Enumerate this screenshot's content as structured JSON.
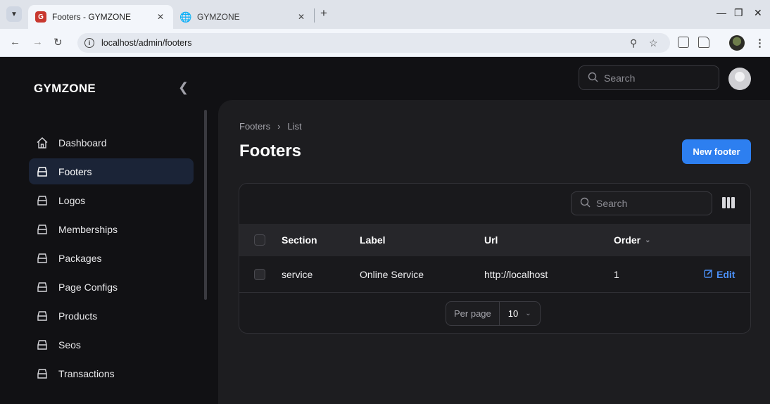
{
  "browser": {
    "tabs": [
      {
        "title": "Footers - GYMZONE",
        "active": true
      },
      {
        "title": "GYMZONE",
        "active": false
      }
    ],
    "url": "localhost/admin/footers"
  },
  "sidebar": {
    "brand": "GYMZONE",
    "items": [
      {
        "label": "Dashboard",
        "icon": "home-icon"
      },
      {
        "label": "Footers",
        "icon": "tray-icon",
        "active": true
      },
      {
        "label": "Logos",
        "icon": "tray-icon"
      },
      {
        "label": "Memberships",
        "icon": "tray-icon"
      },
      {
        "label": "Packages",
        "icon": "tray-icon"
      },
      {
        "label": "Page Configs",
        "icon": "tray-icon"
      },
      {
        "label": "Products",
        "icon": "tray-icon"
      },
      {
        "label": "Seos",
        "icon": "tray-icon"
      },
      {
        "label": "Transactions",
        "icon": "tray-icon"
      }
    ]
  },
  "topbar": {
    "search_placeholder": "Search"
  },
  "page": {
    "breadcrumb": [
      "Footers",
      "List"
    ],
    "title": "Footers",
    "new_button": "New footer"
  },
  "table": {
    "search_placeholder": "Search",
    "columns": [
      "Section",
      "Label",
      "Url",
      "Order"
    ],
    "sorted_column": "Order",
    "rows": [
      {
        "section": "service",
        "label": "Online Service",
        "url": "http://localhost",
        "order": "1",
        "action": "Edit"
      }
    ],
    "per_page_label": "Per page",
    "per_page_value": "10"
  },
  "colors": {
    "accent": "#2d7ff0",
    "link": "#4b8ff5",
    "active_nav": "#1b2437"
  }
}
